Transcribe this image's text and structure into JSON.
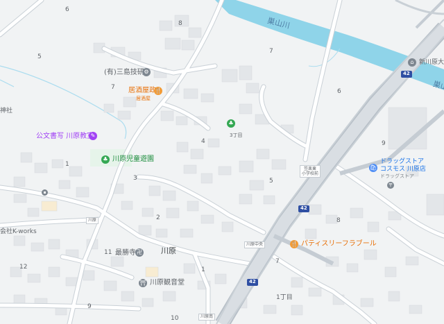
{
  "colors": {
    "land": "#f1f3f4",
    "road": "#ffffff",
    "road_edge": "#c9d0d6",
    "highway": "#c5ccd3",
    "building": "#e3e6e9",
    "river": "#8fd4e9",
    "park": "#e6f4ea"
  },
  "river": {
    "name_main": "巣山川",
    "name_edge": "巣山"
  },
  "block_numbers": {
    "b1": "6",
    "b2": "5",
    "b3": "8",
    "b4": "7",
    "b5": "7",
    "b6": "6",
    "b7": "1",
    "b8": "3",
    "b9": "4",
    "b10": "5",
    "b11": "9",
    "b12": "2",
    "b13": "11",
    "b14": "12",
    "b15": "8",
    "b16": "7",
    "b17": "1",
    "b18": "9",
    "b19": "10"
  },
  "places": {
    "miyoshi": "(有)三島技研",
    "izakaya_name": "居酒屋政",
    "izakaya_sub": "居酒屋",
    "sanchome": "3丁目",
    "kumon": "公文書写 川原教室",
    "jido": "川原児童遊園",
    "shrine_edge": "神社",
    "kworks": "会社K-works",
    "saishoji": "最勝寺",
    "kawara": "川原",
    "kannondo": "川原観音堂",
    "drug_name": "ドラッグストア",
    "drug_name2": "コスモス 川原店",
    "drug_sub": "ドラッグストア",
    "patisserie": "パティスリーフラブール",
    "shinkawara": "新川原大橋",
    "itchome": "1丁目"
  },
  "stops": {
    "kawara_stop": "川原",
    "kawara_mae": "川原中央",
    "kawara_end": "川原南",
    "shogakko": "笠楽東\n小学校前"
  },
  "route_number": "42"
}
